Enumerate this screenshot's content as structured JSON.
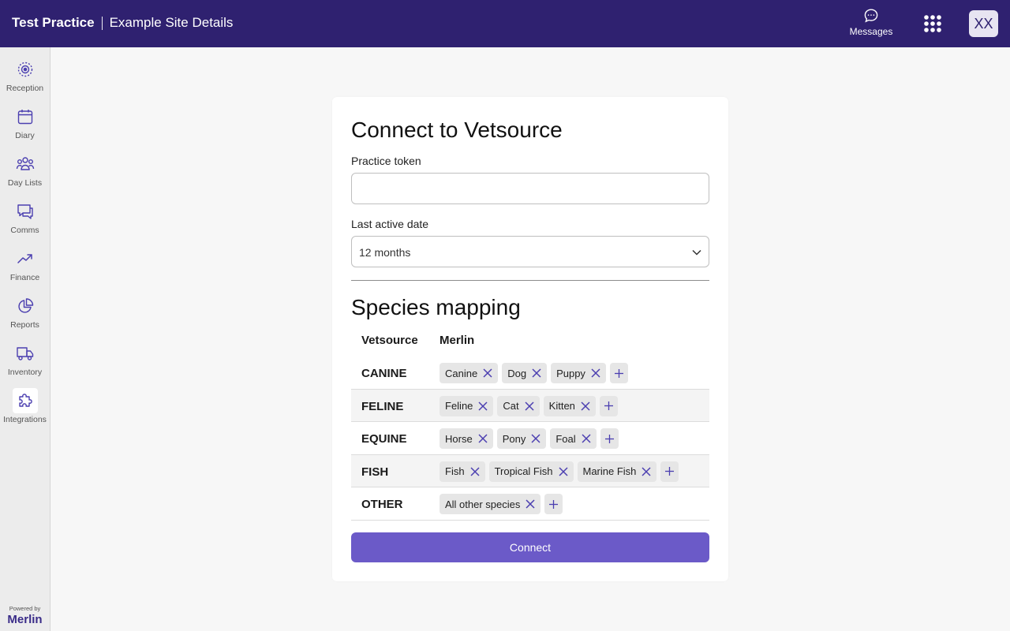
{
  "header": {
    "practice": "Test Practice",
    "site": "Example Site Details",
    "messages_label": "Messages",
    "avatar_initials": "XX"
  },
  "sidebar": {
    "items": [
      {
        "label": "Reception",
        "icon": "reception-icon"
      },
      {
        "label": "Diary",
        "icon": "calendar-icon"
      },
      {
        "label": "Day Lists",
        "icon": "people-icon"
      },
      {
        "label": "Comms",
        "icon": "chat-icon"
      },
      {
        "label": "Finance",
        "icon": "trend-icon"
      },
      {
        "label": "Reports",
        "icon": "pie-icon"
      },
      {
        "label": "Inventory",
        "icon": "truck-icon"
      },
      {
        "label": "Integrations",
        "icon": "puzzle-icon",
        "active": true
      }
    ],
    "powered_by": "Powered by",
    "brand": "Merlin"
  },
  "form": {
    "title": "Connect to Vetsource",
    "token_label": "Practice token",
    "token_value": "",
    "date_label": "Last active date",
    "date_value": "12 months",
    "mapping_title": "Species mapping",
    "col_vetsource": "Vetsource",
    "col_merlin": "Merlin",
    "rows": [
      {
        "species": "CANINE",
        "mapped": [
          "Canine",
          "Dog",
          "Puppy"
        ]
      },
      {
        "species": "FELINE",
        "mapped": [
          "Feline",
          "Cat",
          "Kitten"
        ]
      },
      {
        "species": "EQUINE",
        "mapped": [
          "Horse",
          "Pony",
          "Foal"
        ]
      },
      {
        "species": "FISH",
        "mapped": [
          "Fish",
          "Tropical Fish",
          "Marine Fish"
        ]
      },
      {
        "species": "OTHER",
        "mapped": [
          "All other species"
        ]
      }
    ],
    "connect_label": "Connect"
  },
  "colors": {
    "header_bg": "#2f2170",
    "accent": "#6b5ac8",
    "icon": "#4b3fb0"
  }
}
